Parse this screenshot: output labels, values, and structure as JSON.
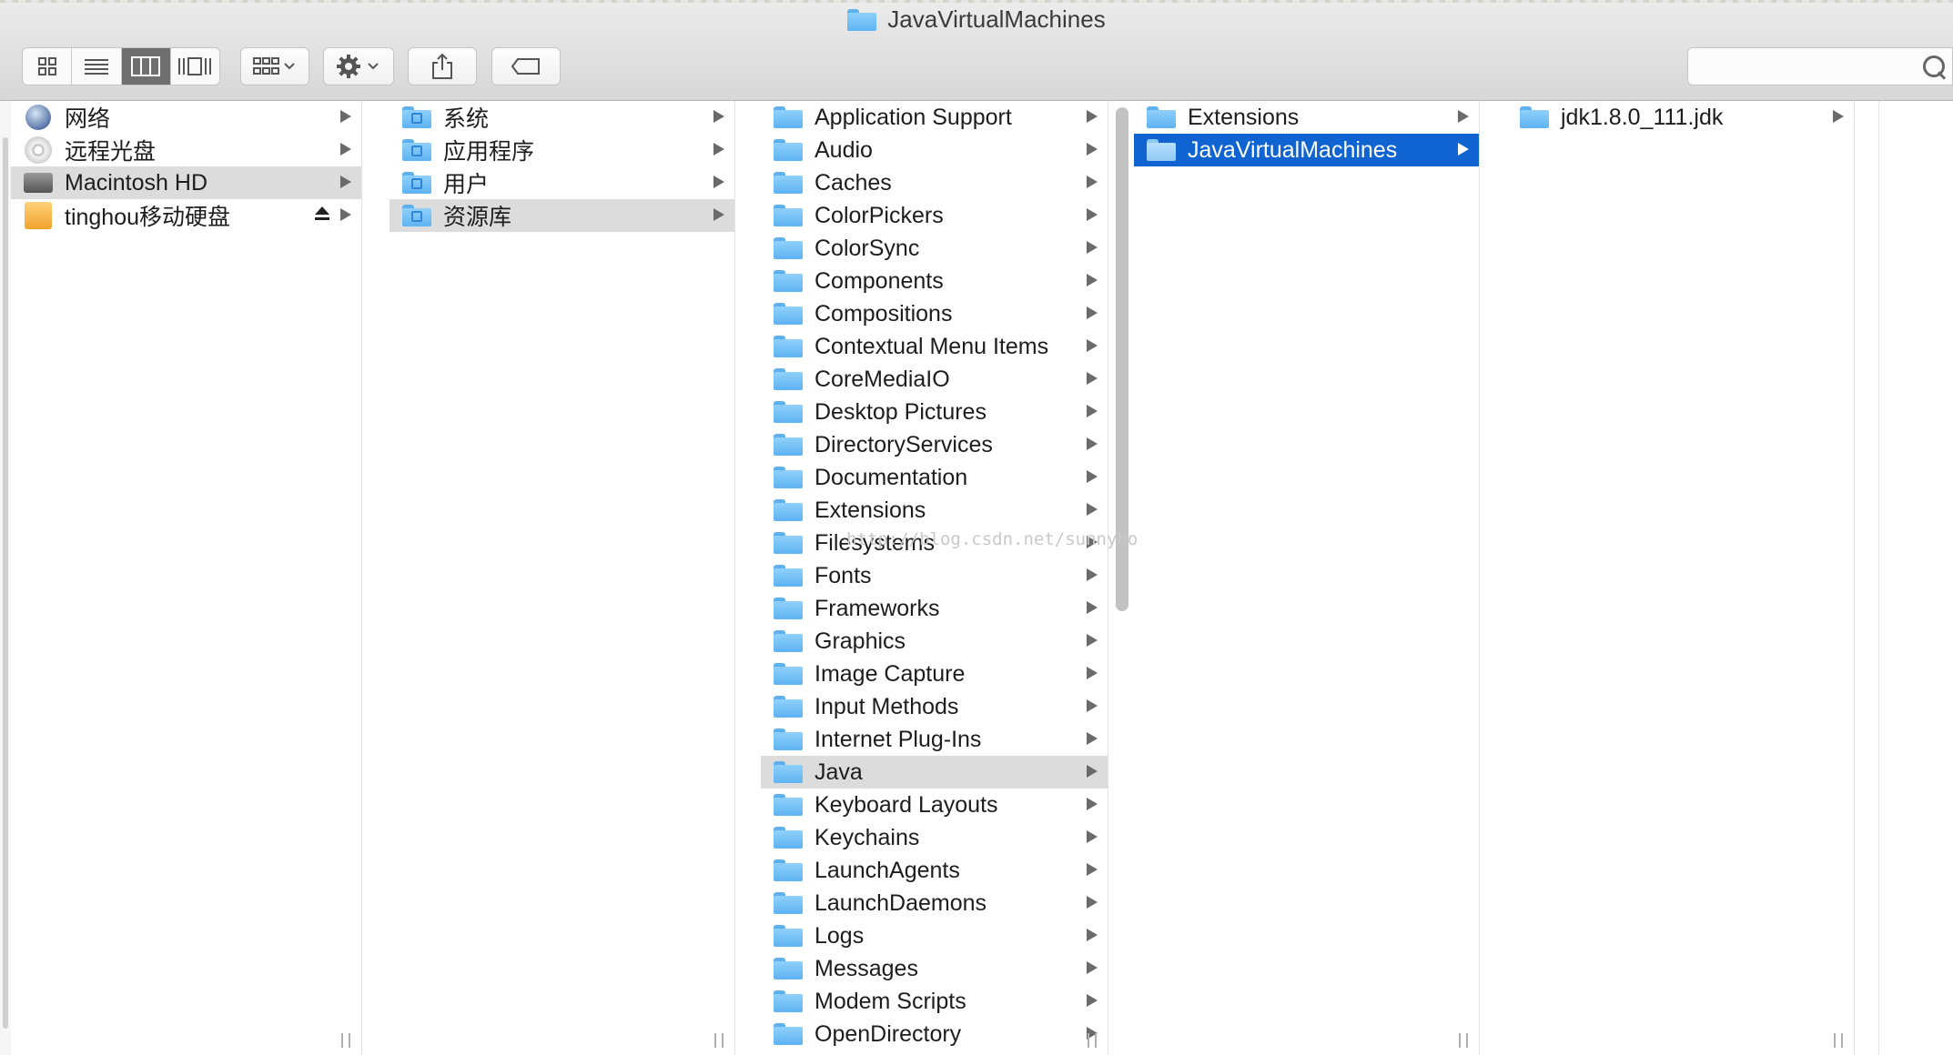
{
  "window": {
    "title": "JavaVirtualMachines"
  },
  "toolbar": {
    "view_buttons": [
      "icon-view",
      "list-view",
      "column-view",
      "cover-flow-view"
    ],
    "active_view": "column-view",
    "arrange_icon": "arrange-grid-icon",
    "action_icon": "gear-icon",
    "share_icon": "share-icon",
    "tag_icon": "tag-icon",
    "search": {
      "value": "",
      "icon": "search-icon"
    }
  },
  "columns": [
    {
      "items": [
        {
          "label": "网络",
          "icon": "network-icon",
          "state": ""
        },
        {
          "label": "远程光盘",
          "icon": "disc-icon",
          "state": ""
        },
        {
          "label": "Macintosh HD",
          "icon": "hard-drive-icon",
          "state": "selected"
        },
        {
          "label": "tinghou移动硬盘",
          "icon": "external-drive-icon",
          "state": "",
          "eject": true
        }
      ]
    },
    {
      "items": [
        {
          "label": "系统",
          "icon": "system-folder-icon",
          "state": ""
        },
        {
          "label": "应用程序",
          "icon": "applications-folder-icon",
          "state": ""
        },
        {
          "label": "用户",
          "icon": "users-folder-icon",
          "state": ""
        },
        {
          "label": "资源库",
          "icon": "library-folder-icon",
          "state": "selected"
        }
      ]
    },
    {
      "items": [
        {
          "label": "Application Support"
        },
        {
          "label": "Audio"
        },
        {
          "label": "Caches"
        },
        {
          "label": "ColorPickers"
        },
        {
          "label": "ColorSync"
        },
        {
          "label": "Components"
        },
        {
          "label": "Compositions"
        },
        {
          "label": "Contextual Menu Items"
        },
        {
          "label": "CoreMediaIO"
        },
        {
          "label": "Desktop Pictures"
        },
        {
          "label": "DirectoryServices"
        },
        {
          "label": "Documentation"
        },
        {
          "label": "Extensions"
        },
        {
          "label": "Filesystems"
        },
        {
          "label": "Fonts"
        },
        {
          "label": "Frameworks"
        },
        {
          "label": "Graphics"
        },
        {
          "label": "Image Capture"
        },
        {
          "label": "Input Methods"
        },
        {
          "label": "Internet Plug-Ins"
        },
        {
          "label": "Java",
          "state": "selected"
        },
        {
          "label": "Keyboard Layouts"
        },
        {
          "label": "Keychains"
        },
        {
          "label": "LaunchAgents"
        },
        {
          "label": "LaunchDaemons"
        },
        {
          "label": "Logs"
        },
        {
          "label": "Messages"
        },
        {
          "label": "Modem Scripts"
        },
        {
          "label": "OpenDirectory"
        }
      ]
    },
    {
      "items": [
        {
          "label": "Extensions"
        },
        {
          "label": "JavaVirtualMachines",
          "state": "highlighted"
        }
      ]
    },
    {
      "items": [
        {
          "label": "jdk1.8.0_111.jdk"
        }
      ]
    }
  ],
  "watermark": "http://blog.csdn.net/sunnyho",
  "colors": {
    "selection_blue": "#0f64d2",
    "inactive_selection": "#dcdcdc",
    "folder_blue": "#5eb3f1"
  }
}
